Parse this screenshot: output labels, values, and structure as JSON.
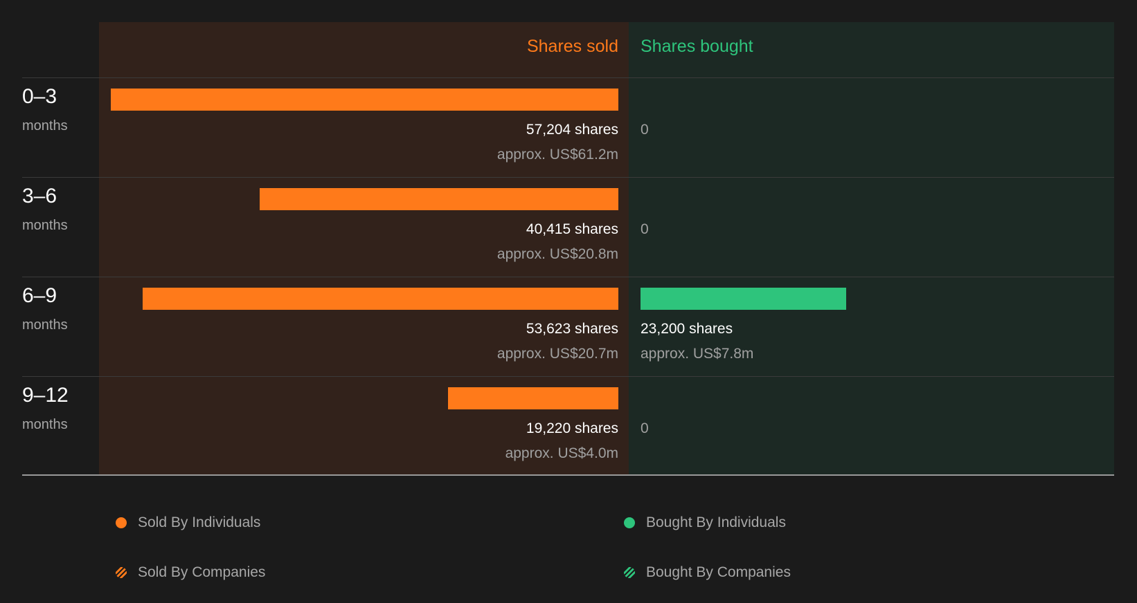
{
  "chart_data": {
    "type": "bar",
    "orientation": "horizontal-diverging",
    "headers": {
      "left": "Shares sold",
      "right": "Shares bought"
    },
    "categories": [
      {
        "range": "0–3",
        "unit": "months"
      },
      {
        "range": "3–6",
        "unit": "months"
      },
      {
        "range": "6–9",
        "unit": "months"
      },
      {
        "range": "9–12",
        "unit": "months"
      }
    ],
    "series": [
      {
        "name": "Shares sold",
        "values": [
          57204,
          40415,
          53623,
          19220
        ],
        "shares_text": [
          "57,204 shares",
          "40,415 shares",
          "53,623 shares",
          "19,220 shares"
        ],
        "usd_text": [
          "approx. US$61.2m",
          "approx. US$20.8m",
          "approx. US$20.7m",
          "approx. US$4.0m"
        ]
      },
      {
        "name": "Shares bought",
        "values": [
          0,
          0,
          23200,
          0
        ],
        "shares_text": [
          "0",
          "0",
          "23,200 shares",
          "0"
        ],
        "usd_text": [
          "",
          "",
          "approx. US$7.8m",
          ""
        ]
      }
    ],
    "legend": [
      {
        "label": "Sold By Individuals",
        "color": "#ff7a1a",
        "pattern": "solid"
      },
      {
        "label": "Bought By Individuals",
        "color": "#2ec47c",
        "pattern": "solid"
      },
      {
        "label": "Sold By Companies",
        "color": "#ff7a1a",
        "pattern": "hatched"
      },
      {
        "label": "Bought By Companies",
        "color": "#2ec47c",
        "pattern": "hatched"
      }
    ],
    "colors": {
      "sold": "#ff7a1a",
      "bought": "#2ec47c"
    },
    "grid": false,
    "legend_position": "bottom"
  }
}
